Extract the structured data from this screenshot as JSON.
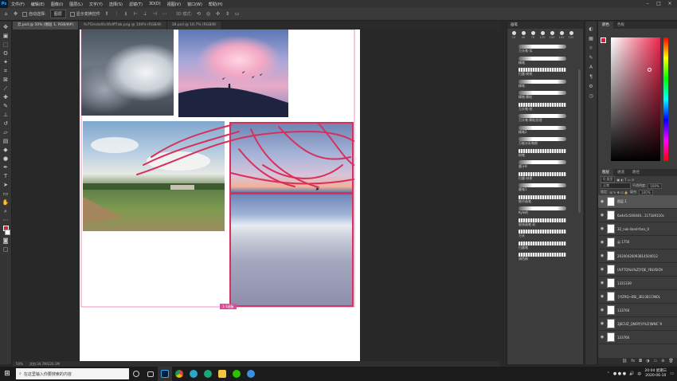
{
  "menubar": {
    "items": [
      "文件(F)",
      "编辑(E)",
      "图像(I)",
      "图层(L)",
      "文字(Y)",
      "选择(S)",
      "滤镜(T)",
      "3D(D)",
      "视图(V)",
      "窗口(W)",
      "帮助(H)"
    ]
  },
  "options": {
    "auto_select_label": "自动选择:",
    "auto_select_value": "图层",
    "show_transform_label": "显示变换控件",
    "mode_label": "3D 模式:"
  },
  "tabs": [
    {
      "label": "云.psd @ 50% (图层 1, RGB/8#)",
      "active": true
    },
    {
      "label": "fe7f2ecbd0c46dff7ab.png @ 100% (RGB/8)",
      "active": false
    },
    {
      "label": "38.psd @ 16.7% (RGB/8)",
      "active": false
    }
  ],
  "canvas": {
    "artboard_badge": "1-1画板"
  },
  "statusbar": {
    "zoom": "50%",
    "doc_size": "文档:34.7M/220.1M"
  },
  "brush_panel": {
    "title": "画笔",
    "tip_sizes": [
      "10",
      "40",
      "70",
      "120",
      "100",
      "100",
      "120"
    ],
    "brushes": [
      {
        "label": "万头笔-实",
        "rough": false
      },
      {
        "label": "精笔",
        "rough": false
      },
      {
        "label": "扫墨-刷毛",
        "rough": true
      },
      {
        "label": "精笔",
        "rough": false
      },
      {
        "label": "精笔-颗粒",
        "rough": false
      },
      {
        "label": "万头笔-枯",
        "rough": true
      },
      {
        "label": "万头笔-颗粒纹理",
        "rough": false
      },
      {
        "label": "精笔2",
        "rough": false
      },
      {
        "label": "万能水彩笔刷",
        "rough": false
      },
      {
        "label": "粉笔",
        "rough": true
      },
      {
        "label": "墨汁B",
        "rough": false
      },
      {
        "label": "扫墨-材质",
        "rough": true
      },
      {
        "label": "墨笔1",
        "rough": false
      },
      {
        "label": "细节画笔",
        "rough": true
      },
      {
        "label": "Kyle的",
        "rough": false
      },
      {
        "label": "星体画笔-彩",
        "rough": true
      },
      {
        "label": "万头",
        "rough": true
      },
      {
        "label": "扫墨笔",
        "rough": true
      },
      {
        "label": "调色刷",
        "rough": true
      }
    ]
  },
  "color_panel": {
    "tabs": [
      "颜色",
      "色板"
    ],
    "fg": "#d41e3c",
    "bg": "#ffffff"
  },
  "layers_panel": {
    "tabs": [
      "图层",
      "通道",
      "路径"
    ],
    "kind_label": "Q 类型",
    "blend_mode": "正常",
    "opacity_label": "不透明度:",
    "opacity_value": "100%",
    "lock_label": "锁定:",
    "fill_label": "填充:",
    "fill_value": "100%",
    "layers": [
      {
        "name": "图层 1",
        "selected": true
      },
      {
        "name": "6a4e5c540440...1171b9110c",
        "selected": false
      },
      {
        "name": "32_nak-iland-fans_0",
        "selected": false
      },
      {
        "name": "云 1750",
        "selected": false
      },
      {
        "name": "20200426093814504012",
        "selected": false
      },
      {
        "name": "UVFTQ%U%Z]YQE_YBLYEIOV",
        "selected": false
      },
      {
        "name": "1321339",
        "selected": false
      },
      {
        "name": "{YIZ9Q~BSI_3EU3ECCIN0L",
        "selected": false
      },
      {
        "name": "133766",
        "selected": false
      },
      {
        "name": "3JECUZ_QNOY[VYLD]WNC`9",
        "selected": false
      },
      {
        "name": "133766",
        "selected": false
      }
    ]
  },
  "taskbar": {
    "search_placeholder": "在这里输入你要搜索的内容",
    "time": "20:04 星期三",
    "date": "2020-06-10"
  }
}
